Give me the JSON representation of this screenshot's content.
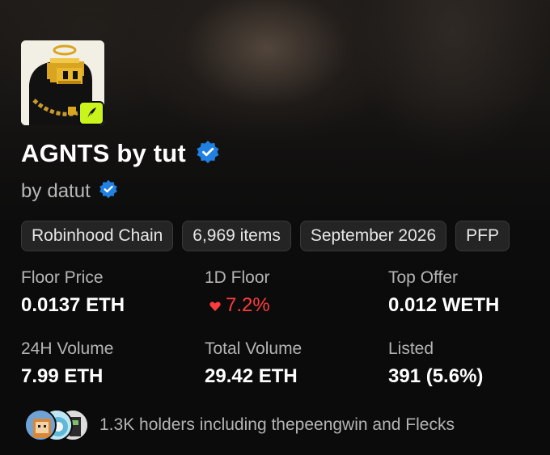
{
  "collection": {
    "title": "AGNTS by tut",
    "creator_prefix": "by",
    "creator_name": "datut",
    "chain_badge_icon": "robinhood-feather-icon",
    "accent_badge_color": "#c9f51c",
    "verified_color": "#2081e2"
  },
  "chips": [
    "Robinhood Chain",
    "6,969 items",
    "September 2026",
    "PFP"
  ],
  "stats": [
    {
      "label": "Floor Price",
      "value": "0.0137 ETH",
      "trend": "none"
    },
    {
      "label": "1D Floor",
      "value": "7.2%",
      "trend": "down"
    },
    {
      "label": "Top Offer",
      "value": "0.012 WETH",
      "trend": "none"
    },
    {
      "label": "24H Volume",
      "value": "7.99 ETH",
      "trend": "none"
    },
    {
      "label": "Total Volume",
      "value": "29.42 ETH",
      "trend": "none"
    },
    {
      "label": "Listed",
      "value": "391 (5.6%)",
      "trend": "none"
    }
  ],
  "holders": {
    "text": "1.3K holders including thepeengwin and Flecks"
  }
}
